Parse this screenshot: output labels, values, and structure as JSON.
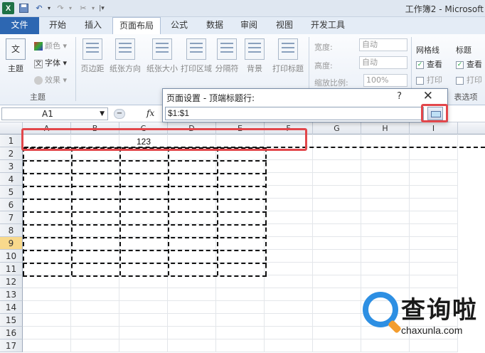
{
  "window": {
    "title": "工作簿2 - Microsoft"
  },
  "tabs": [
    {
      "label": "文件"
    },
    {
      "label": "开始"
    },
    {
      "label": "插入"
    },
    {
      "label": "页面布局"
    },
    {
      "label": "公式"
    },
    {
      "label": "数据"
    },
    {
      "label": "审阅"
    },
    {
      "label": "视图"
    },
    {
      "label": "开发工具"
    }
  ],
  "ribbon": {
    "themes": {
      "big": "主题",
      "colors": "颜色",
      "fonts": "字体",
      "effects": "效果",
      "group_label": "主题"
    },
    "page_setup": {
      "margins": "页边距",
      "orientation": "纸张方向",
      "size": "纸张大小",
      "print_area": "打印区域",
      "breaks": "分隔符",
      "background": "背景",
      "print_titles": "打印标题"
    },
    "scale": {
      "width_label": "宽度:",
      "width_value": "自动",
      "height_label": "高度:",
      "height_value": "自动",
      "scale_label": "缩放比例:",
      "scale_value": "100%"
    },
    "gridlines": {
      "title": "网格线",
      "view": "查看",
      "print": "打印"
    },
    "headings": {
      "title": "标题",
      "view": "查看",
      "print": "打印"
    },
    "sheet_options_label": "表选项"
  },
  "formula_bar": {
    "name_box": "A1",
    "fx": "fx"
  },
  "dialog": {
    "title": "页面设置 - 顶端标题行:",
    "help": "?",
    "close": "✕",
    "input_value": "$1:$1"
  },
  "grid": {
    "columns": [
      "A",
      "B",
      "C",
      "D",
      "E",
      "F",
      "G",
      "H",
      "I"
    ],
    "rows": [
      "1",
      "2",
      "3",
      "4",
      "5",
      "6",
      "7",
      "8",
      "9",
      "10",
      "11",
      "12",
      "13",
      "14",
      "15",
      "16",
      "17"
    ],
    "selected_row": "9",
    "cell_value": "123"
  },
  "watermark": {
    "brand": "查询啦",
    "url": "chaxunla.com"
  }
}
